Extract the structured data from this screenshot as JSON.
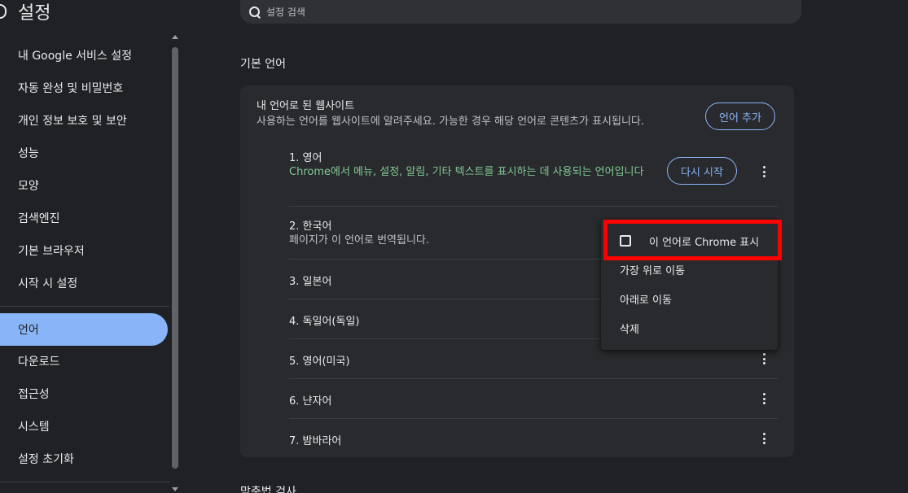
{
  "header": {
    "title": "설정",
    "search_placeholder": "설정 검색"
  },
  "sidebar": {
    "items": [
      {
        "label": "내 Google 서비스 설정"
      },
      {
        "label": "자동 완성 및 비밀번호"
      },
      {
        "label": "개인 정보 보호 및 보안"
      },
      {
        "label": "성능"
      },
      {
        "label": "모양"
      },
      {
        "label": "검색엔진"
      },
      {
        "label": "기본 브라우저"
      },
      {
        "label": "시작 시 설정"
      },
      {
        "label": "언어",
        "active": true
      },
      {
        "label": "다운로드"
      },
      {
        "label": "접근성"
      },
      {
        "label": "시스템"
      },
      {
        "label": "설정 초기화"
      }
    ]
  },
  "main": {
    "section_title": "기본 언어",
    "card": {
      "title": "내 언어로 된 웹사이트",
      "description": "사용하는 언어를 웹사이트에 알려주세요. 가능한 경우 해당 언어로 콘텐츠가 표시됩니다.",
      "add_button": "언어 추가",
      "restart_button": "다시 시작",
      "languages": [
        {
          "name": "1. 영어",
          "desc": "Chrome에서 메뉴, 설정, 알림, 기타 텍스트를 표시하는 데 사용되는 언어입니다"
        },
        {
          "name": "2. 한국어",
          "desc": "페이지가 이 언어로 번역됩니다."
        },
        {
          "name": "3. 일본어"
        },
        {
          "name": "4. 독일어(독일)"
        },
        {
          "name": "5. 영어(미국)"
        },
        {
          "name": "6. 냔자어"
        },
        {
          "name": "7. 밤바라어"
        }
      ]
    },
    "next_section_title": "맞춤법 검사"
  },
  "menu": {
    "items": [
      {
        "label": "이 언어로 Chrome 표시",
        "checked": false
      },
      {
        "label": "가장 위로 이동"
      },
      {
        "label": "아래로 이동"
      },
      {
        "label": "삭제"
      }
    ],
    "highlight_color": "#ff0000"
  },
  "colors": {
    "accent": "#8ab4f8",
    "green_text": "#81c995",
    "background": "#202124",
    "card": "#292a2d"
  }
}
